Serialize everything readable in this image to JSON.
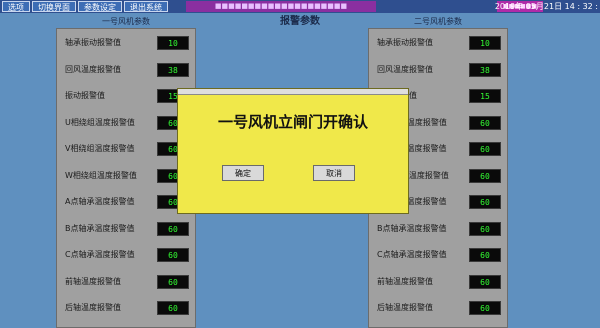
{
  "topbar": {
    "buttons": [
      "选项",
      "切换界面",
      "参数设定",
      "退出系统"
    ],
    "banner": "■■■■■■■■■■■■■■■■■■■■",
    "tag": "■■■■■■",
    "datetime": "2019年 05月21日   14 : 32 :"
  },
  "page_title": "报警参数",
  "left_panel": {
    "title": "一号风机参数",
    "rows": [
      {
        "label": "轴承振动报警值",
        "value": "10"
      },
      {
        "label": "回风温度报警值",
        "value": "38"
      },
      {
        "label": "振动报警值",
        "value": "15"
      },
      {
        "label": "U相绕组温度报警值",
        "value": "60"
      },
      {
        "label": "V相绕组温度报警值",
        "value": "60"
      },
      {
        "label": "W相绕组温度报警值",
        "value": "60"
      },
      {
        "label": "A点轴承温度报警值",
        "value": "60"
      },
      {
        "label": "B点轴承温度报警值",
        "value": "60"
      },
      {
        "label": "C点轴承温度报警值",
        "value": "60"
      },
      {
        "label": "前轴温度报警值",
        "value": "60"
      },
      {
        "label": "后轴温度报警值",
        "value": "60"
      }
    ]
  },
  "right_panel": {
    "title": "二号风机参数",
    "rows": [
      {
        "label": "轴承振动报警值",
        "value": "10"
      },
      {
        "label": "回风温度报警值",
        "value": "38"
      },
      {
        "label": "振动报警值",
        "value": "15"
      },
      {
        "label": "U相绕组温度报警值",
        "value": "60"
      },
      {
        "label": "V相绕组温度报警值",
        "value": "60"
      },
      {
        "label": "W相绕组温度报警值",
        "value": "60"
      },
      {
        "label": "A点轴承温度报警值",
        "value": "60"
      },
      {
        "label": "B点轴承温度报警值",
        "value": "60"
      },
      {
        "label": "C点轴承温度报警值",
        "value": "60"
      },
      {
        "label": "前轴温度报警值",
        "value": "60"
      },
      {
        "label": "后轴温度报警值",
        "value": "60"
      }
    ]
  },
  "dialog": {
    "message": "一号风机立闸门开确认",
    "ok_label": "确定",
    "cancel_label": "取消"
  }
}
